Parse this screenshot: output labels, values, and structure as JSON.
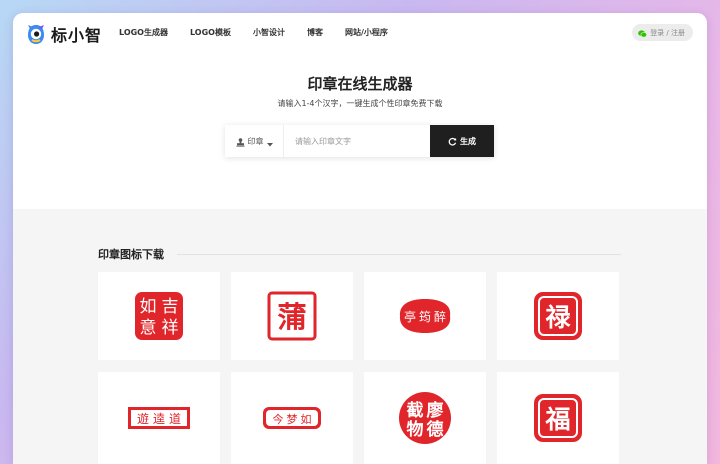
{
  "nav": {
    "brand": "标小智",
    "menu": [
      "LOGO生成器",
      "LOGO模板",
      "小智设计",
      "博客",
      "网站/小程序"
    ],
    "login": "登录 / 注册"
  },
  "hero": {
    "title": "印章在线生成器",
    "subtitle": "请输入1-4个汉字，一键生成个性印章免费下载"
  },
  "search": {
    "type_label": "印章",
    "placeholder": "请输入印章文字",
    "button_label": "生成"
  },
  "gallery": {
    "title": "印章图标下载",
    "stamps": [
      {
        "chars": [
          "如",
          "吉",
          "意",
          "祥"
        ],
        "style": "square-4"
      },
      {
        "chars": [
          "蒲"
        ],
        "style": "frame-1"
      },
      {
        "chars": [
          "亭",
          "筠",
          "醉"
        ],
        "style": "oval-white"
      },
      {
        "chars": [
          "禄"
        ],
        "style": "rounded-1"
      },
      {
        "chars": [
          "遊",
          "逵",
          "道"
        ],
        "style": "rect-white"
      },
      {
        "chars": [
          "今",
          "梦",
          "如"
        ],
        "style": "pill-white"
      },
      {
        "chars": [
          "截",
          "廖",
          "物",
          "德"
        ],
        "style": "circle-4"
      },
      {
        "chars": [
          "福"
        ],
        "style": "rounded-1"
      }
    ]
  },
  "colors": {
    "stamp": "#e0262b",
    "button": "#1f1f1f"
  }
}
